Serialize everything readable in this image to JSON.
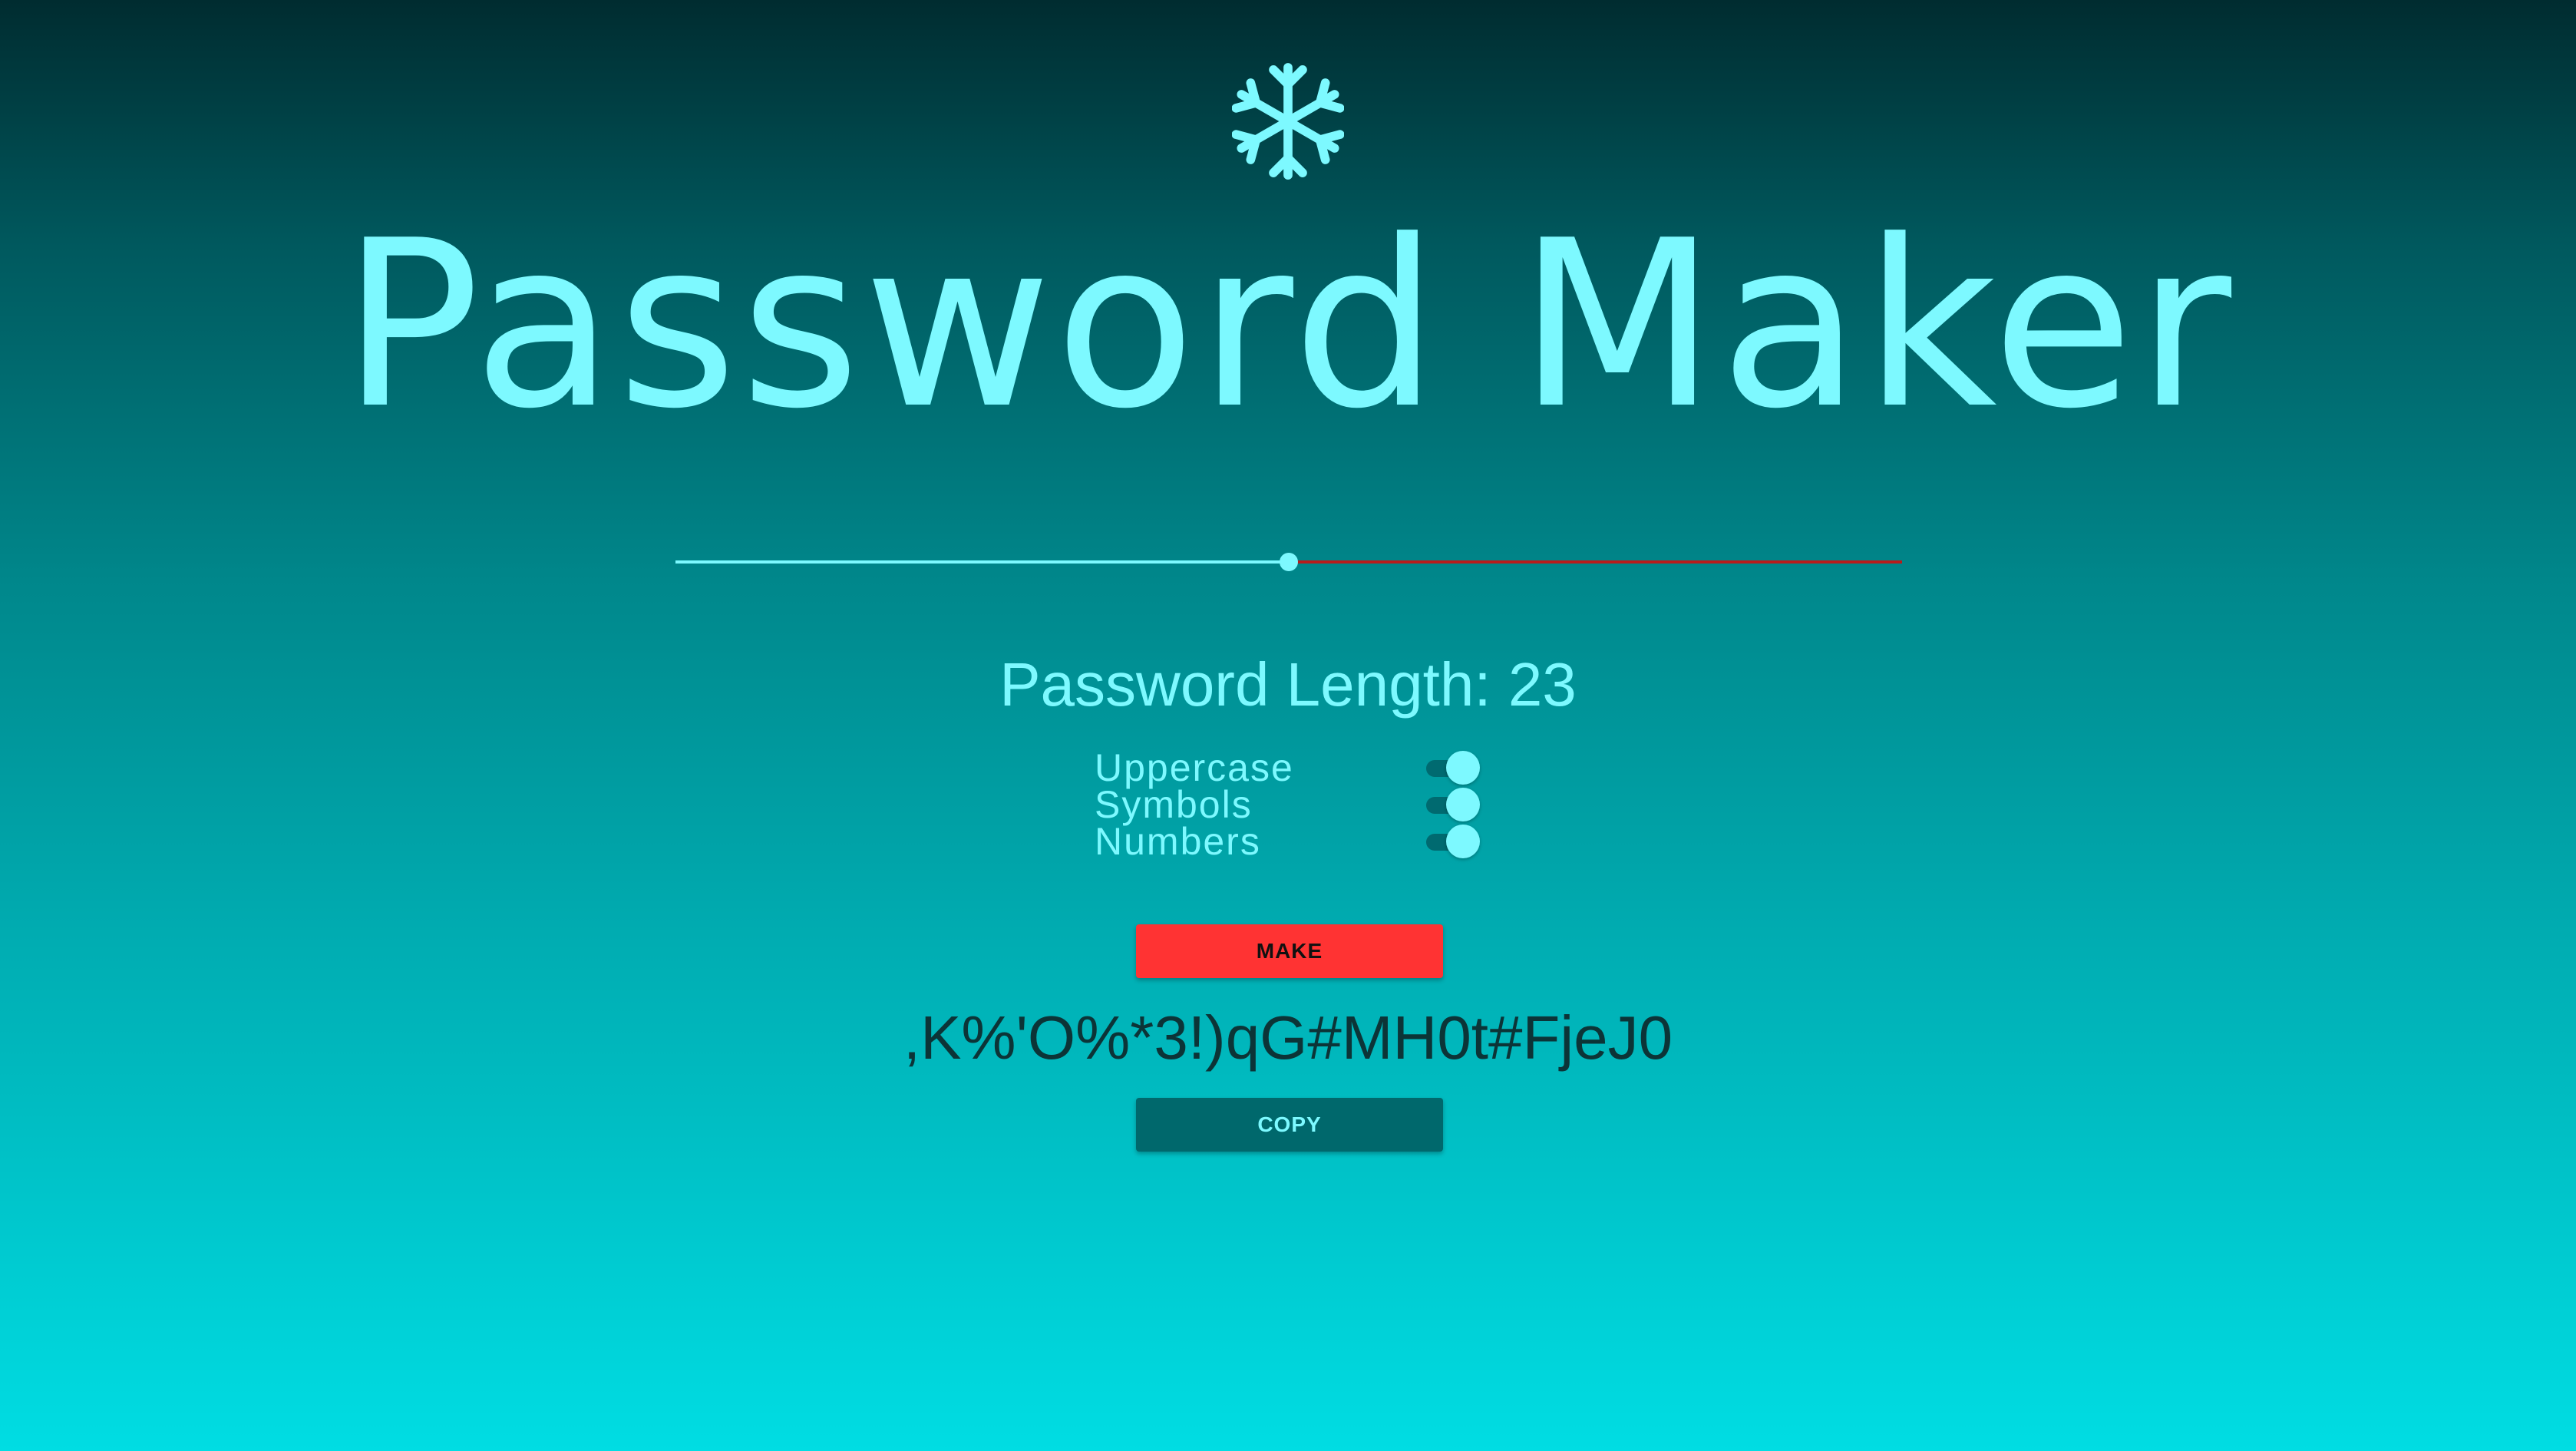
{
  "app": {
    "logo_icon": "snowflake-icon",
    "title": "Password Maker",
    "accent_color": "#7df9ff",
    "make_color": "#ff3333",
    "copy_color": "#00686c",
    "slider_remaining_color": "#b71c1c"
  },
  "length": {
    "label": "Password Length:",
    "value": "23",
    "slider_min": 0,
    "slider_max": 46,
    "slider_value": 23
  },
  "options": [
    {
      "label": "Uppercase",
      "checked": true
    },
    {
      "label": "Symbols",
      "checked": true
    },
    {
      "label": "Numbers",
      "checked": true
    }
  ],
  "actions": {
    "make_label": "MAKE",
    "copy_label": "COPY"
  },
  "output": {
    "password": ",K%'O%*3!)qG#MH0t#FjeJ0"
  }
}
